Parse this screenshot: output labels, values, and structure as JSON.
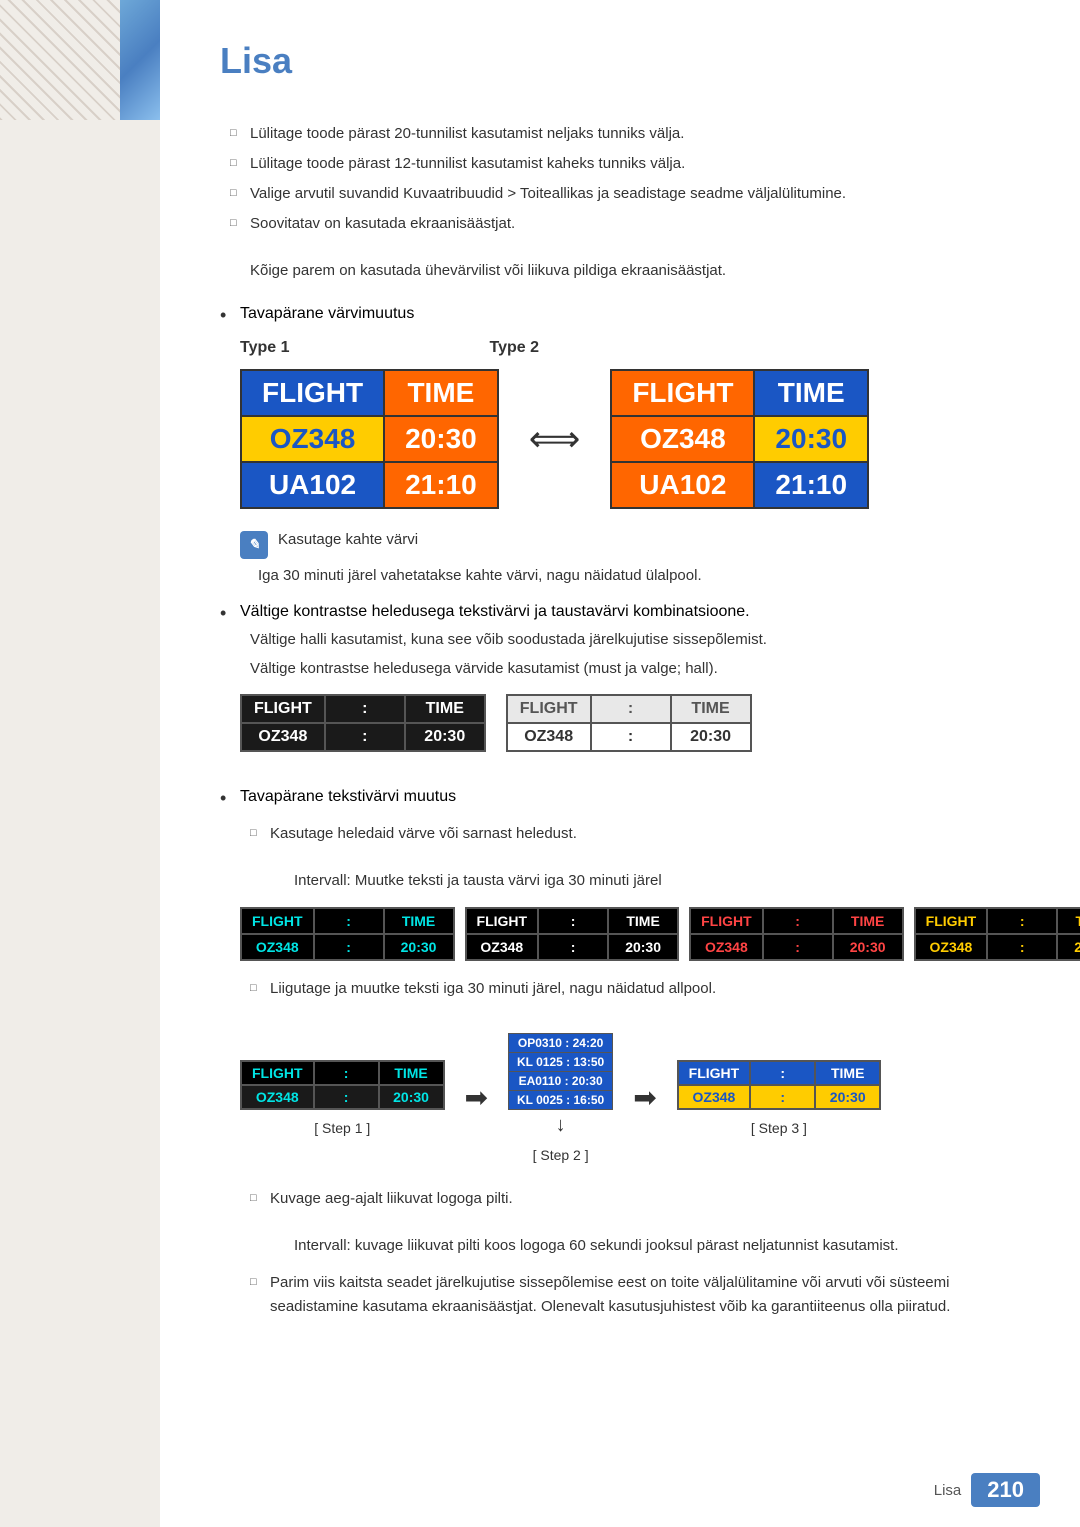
{
  "page": {
    "title": "Lisa",
    "footer_label": "Lisa",
    "footer_page": "210"
  },
  "sidebar": {
    "blue_bar": true,
    "diagonal_pattern": true
  },
  "content": {
    "top_bullets": [
      "Lülitage toode pärast 20-tunnilist kasutamist neljaks tunniks välja.",
      "Lülitage toode pärast 12-tunnilist kasutamist kaheks tunniks välja.",
      "Valige arvutil suvandid Kuvaatribuudid > Toiteallikas ja seadistage seadme väljalülitumine.",
      "Soovitatav on kasutada ekraanisäästjat."
    ],
    "indented_note": "Kõige parem on kasutada ühevärvilist või liikuva pildiga ekraanisäästjat.",
    "section1_bullet": "Tavapärane värvimuutus",
    "type1_label": "Type 1",
    "type2_label": "Type 2",
    "flight_header_col1": "FLIGHT",
    "flight_header_col2": "TIME",
    "flight_row1_col1": "OZ348",
    "flight_row1_col2": "20:30",
    "flight_row2_col1": "UA102",
    "flight_row2_col2": "21:10",
    "note_bold": "Kasutage kahte värvi",
    "note_sub": "Iga 30 minuti järel vahetatakse kahte värvi, nagu näidatud ülalpool.",
    "section2_bullet": "Vältige kontrastse heledusega tekstivärvi ja taustavärvi kombinatsioone.",
    "section2_text1": "Vältige halli kasutamist, kuna see võib soodustada järelkujutise sissepõlemist.",
    "section2_text2": "Vältige kontrastse heledusega värvide kasutamist (must ja valge; hall).",
    "section3_bullet": "Tavapärane tekstivärvi muutus",
    "section3_sub1": "Kasutage heledaid värve või sarnast heledust.",
    "section3_sub1_note": "Intervall: Muutke teksti ja tausta värvi iga 30 minuti järel",
    "section3_sub2": "Liigutage ja muutke teksti iga 30 minuti järel, nagu näidatud allpool.",
    "step1_label": "[ Step 1 ]",
    "step2_label": "[ Step 2 ]",
    "step3_label": "[ Step 3 ]",
    "step2_rows": [
      "OP0310 :  24:20",
      "KL 0125 :  13:50",
      "EA0110 :  20:30",
      "KL 0025 :  16:50"
    ],
    "section4_sub": "Kuvage aeg-ajalt liikuvat logoga pilti.",
    "section4_sub_note": "Intervall: kuvage liikuvat pilti koos logoga 60 sekundi jooksul pärast neljatunnist kasutamist.",
    "section5_sub": "Parim viis kaitsta seadet järelkujutise sissepõlemise eest on toite väljalülitamine või arvuti või süsteemi seadistamine kasutama ekraanisäästjat. Olenevalt kasutusjuhistest võib ka garantiiteenus olla piiratud."
  }
}
